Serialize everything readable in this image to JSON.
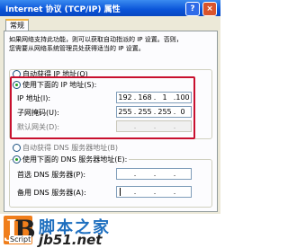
{
  "window": {
    "title": "Internet 协议 (TCP/IP) 属性",
    "help_glyph": "?",
    "close_glyph": "×"
  },
  "tab": {
    "label": "常规"
  },
  "description": [
    "如果网络支持此功能，则可以获取自动指派的 IP 设置。否则，",
    "您需要从网络系统管理员处获得适当的 IP 设置。"
  ],
  "ip": {
    "auto_label": "自动获得 IP 地址(O)",
    "manual_label": "使用下面的 IP 地址(S):",
    "address_label": "IP 地址(I):",
    "address": [
      "192",
      "168",
      "1",
      "100"
    ],
    "mask_label": "子网掩码(U):",
    "mask": [
      "255",
      "255",
      "255",
      "0"
    ],
    "gateway_label": "默认网关(D):",
    "gateway": [
      "",
      "",
      "",
      ""
    ]
  },
  "dns": {
    "auto_label": "自动获得 DNS 服务器地址(B)",
    "manual_label": "使用下面的 DNS 服务器地址(E):",
    "preferred_label": "首选 DNS 服务器(P):",
    "alternate_label": "备用 DNS 服务器(A):"
  },
  "watermark": {
    "name": "脚本之家",
    "url": "jb51.net",
    "script": "Script",
    "accent": "#f07e1b"
  },
  "colors": {
    "highlight": "#c8102e",
    "title_bar": "#0a54d8"
  }
}
